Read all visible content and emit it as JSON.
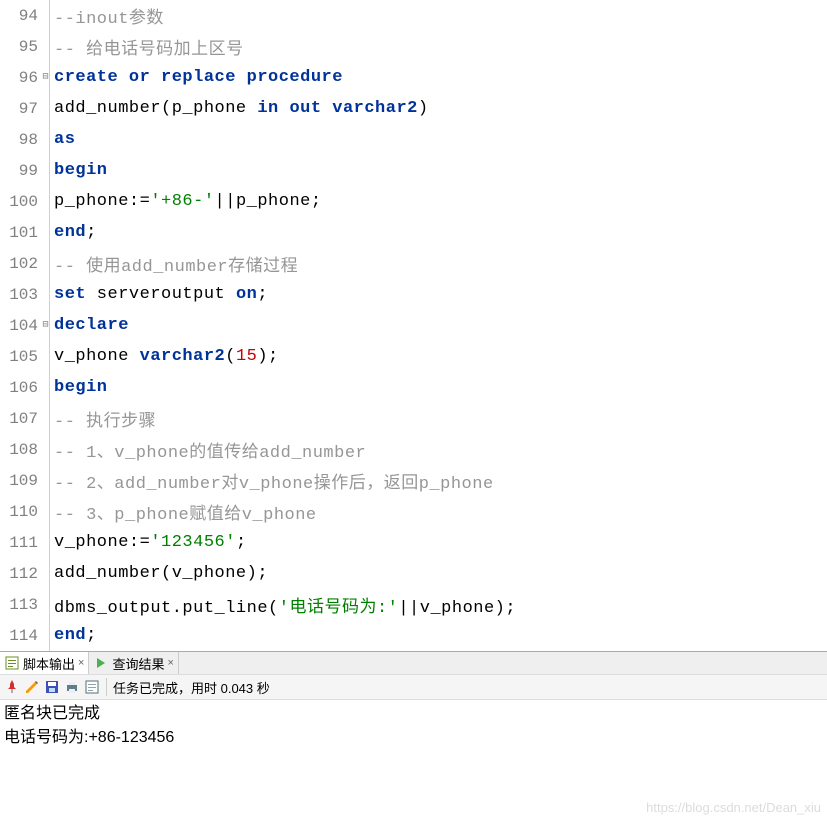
{
  "lines": [
    {
      "n": "94",
      "fold": "",
      "tokens": [
        {
          "t": "--inout参数",
          "c": "comment"
        }
      ]
    },
    {
      "n": "95",
      "fold": "",
      "tokens": [
        {
          "t": "-- 给电话号码加上区号",
          "c": "comment"
        }
      ]
    },
    {
      "n": "96",
      "fold": "⊟",
      "tokens": [
        {
          "t": "create or replace procedure",
          "c": "kw"
        }
      ]
    },
    {
      "n": "97",
      "fold": "",
      "tokens": [
        {
          "t": "add_number(p_phone ",
          "c": "ident"
        },
        {
          "t": "in out varchar2",
          "c": "kw"
        },
        {
          "t": ")",
          "c": "punct"
        }
      ]
    },
    {
      "n": "98",
      "fold": "",
      "tokens": [
        {
          "t": "as",
          "c": "kw"
        }
      ]
    },
    {
      "n": "99",
      "fold": "",
      "tokens": [
        {
          "t": "begin",
          "c": "kw"
        }
      ]
    },
    {
      "n": "100",
      "fold": "",
      "tokens": [
        {
          "t": "p_phone:=",
          "c": "ident"
        },
        {
          "t": "'+86-'",
          "c": "str"
        },
        {
          "t": "||p_phone;",
          "c": "ident"
        }
      ]
    },
    {
      "n": "101",
      "fold": "",
      "tokens": [
        {
          "t": "end",
          "c": "kw"
        },
        {
          "t": ";",
          "c": "punct"
        }
      ]
    },
    {
      "n": "102",
      "fold": "",
      "tokens": [
        {
          "t": "-- 使用add_number存储过程",
          "c": "comment"
        }
      ]
    },
    {
      "n": "103",
      "fold": "",
      "tokens": [
        {
          "t": "set",
          "c": "kw"
        },
        {
          "t": " serveroutput ",
          "c": "ident"
        },
        {
          "t": "on",
          "c": "kw"
        },
        {
          "t": ";",
          "c": "punct"
        }
      ]
    },
    {
      "n": "104",
      "fold": "⊟",
      "tokens": [
        {
          "t": "declare",
          "c": "kw"
        }
      ]
    },
    {
      "n": "105",
      "fold": "",
      "tokens": [
        {
          "t": "v_phone ",
          "c": "ident"
        },
        {
          "t": "varchar2",
          "c": "kw"
        },
        {
          "t": "(",
          "c": "punct"
        },
        {
          "t": "15",
          "c": "num"
        },
        {
          "t": ");",
          "c": "punct"
        }
      ]
    },
    {
      "n": "106",
      "fold": "",
      "tokens": [
        {
          "t": "begin",
          "c": "kw"
        }
      ]
    },
    {
      "n": "107",
      "fold": "",
      "tokens": [
        {
          "t": "-- 执行步骤",
          "c": "comment"
        }
      ]
    },
    {
      "n": "108",
      "fold": "",
      "tokens": [
        {
          "t": "-- 1、v_phone的值传给add_number",
          "c": "comment"
        }
      ]
    },
    {
      "n": "109",
      "fold": "",
      "tokens": [
        {
          "t": "-- 2、add_number对v_phone操作后，返回p_phone",
          "c": "comment"
        }
      ]
    },
    {
      "n": "110",
      "fold": "",
      "tokens": [
        {
          "t": "-- 3、p_phone赋值给v_phone",
          "c": "comment"
        }
      ]
    },
    {
      "n": "111",
      "fold": "",
      "tokens": [
        {
          "t": "v_phone:=",
          "c": "ident"
        },
        {
          "t": "'123456'",
          "c": "str"
        },
        {
          "t": ";",
          "c": "punct"
        }
      ]
    },
    {
      "n": "112",
      "fold": "",
      "tokens": [
        {
          "t": "add_number(v_phone);",
          "c": "ident"
        }
      ]
    },
    {
      "n": "113",
      "fold": "",
      "tokens": [
        {
          "t": "dbms_output.put_line(",
          "c": "ident"
        },
        {
          "t": "'电话号码为:'",
          "c": "str"
        },
        {
          "t": "||v_phone);",
          "c": "ident"
        }
      ]
    },
    {
      "n": "114",
      "fold": "",
      "tokens": [
        {
          "t": "end",
          "c": "kw"
        },
        {
          "t": ";",
          "c": "punct"
        }
      ]
    }
  ],
  "tabs": {
    "script_output": "脚本输出",
    "query_result": "查询结果"
  },
  "toolbar": {
    "status": "任务已完成，用时 0.043 秒"
  },
  "output": {
    "line1": "匿名块已完成",
    "line2": "电话号码为:+86-123456"
  },
  "watermark": "https://blog.csdn.net/Dean_xiu"
}
